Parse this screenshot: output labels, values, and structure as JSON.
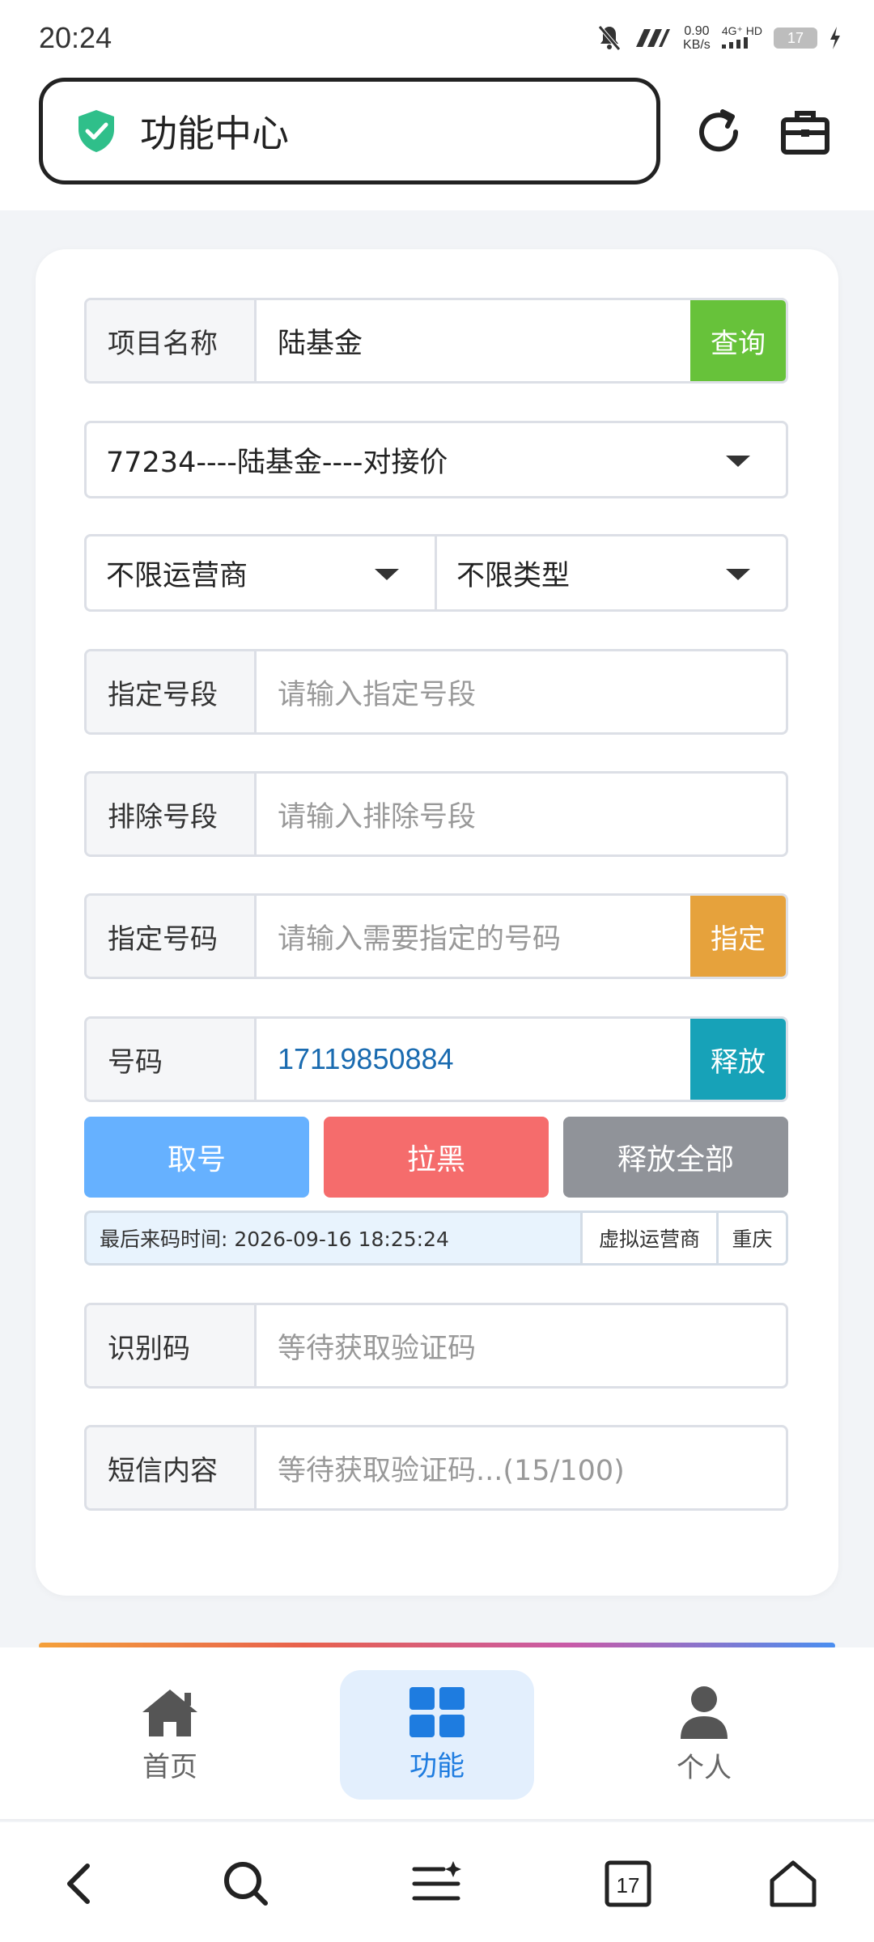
{
  "status_bar": {
    "time": "20:24",
    "speed_value": "0.90",
    "speed_unit": "KB/s",
    "network": "4G⁺ HD",
    "battery": "17",
    "icons": [
      "mute-bell-icon",
      "wifi-icon",
      "signal-icon",
      "battery-icon",
      "charging-icon"
    ]
  },
  "header": {
    "title": "功能中心",
    "icons": [
      "shield-check-icon",
      "refresh-icon",
      "toolbox-icon"
    ]
  },
  "form": {
    "project": {
      "label": "项目名称",
      "value": "陆基金",
      "button": "查询"
    },
    "project_select": {
      "selected": "77234----陆基金----对接价"
    },
    "carrier_select": {
      "selected": "不限运营商"
    },
    "type_select": {
      "selected": "不限类型"
    },
    "segment_include": {
      "label": "指定号段",
      "placeholder": "请输入指定号段"
    },
    "segment_exclude": {
      "label": "排除号段",
      "placeholder": "请输入排除号段"
    },
    "specify_number": {
      "label": "指定号码",
      "placeholder": "请输入需要指定的号码",
      "button": "指定"
    },
    "number": {
      "label": "号码",
      "value": "17119850884",
      "button": "释放"
    },
    "actions": {
      "get_number": "取号",
      "blacklist": "拉黑",
      "release_all": "释放全部"
    },
    "info": {
      "last_code_time": "最后来码时间: 2026-09-16 18:25:24",
      "carrier": "虚拟运营商",
      "region": "重庆"
    },
    "code": {
      "label": "识别码",
      "placeholder": "等待获取验证码"
    },
    "sms": {
      "label": "短信内容",
      "placeholder": "等待获取验证码...(15/100)"
    }
  },
  "tabs": [
    {
      "label": "首页",
      "icon": "home-icon"
    },
    {
      "label": "功能",
      "icon": "grid-icon",
      "active": true
    },
    {
      "label": "个人",
      "icon": "person-icon"
    }
  ],
  "nav": {
    "icons": [
      "back-icon",
      "search-icon",
      "menu-sparkle-icon",
      "calendar-icon",
      "home-outline-icon"
    ],
    "calendar_day": "17"
  },
  "colors": {
    "query_green": "#67c23a",
    "specify_orange": "#e6a23c",
    "release_teal": "#17a2b8",
    "get_blue": "#66b1ff",
    "black_red": "#f56c6c",
    "release_all_gray": "#909399",
    "active_tab_blue": "#1e7ce0"
  }
}
